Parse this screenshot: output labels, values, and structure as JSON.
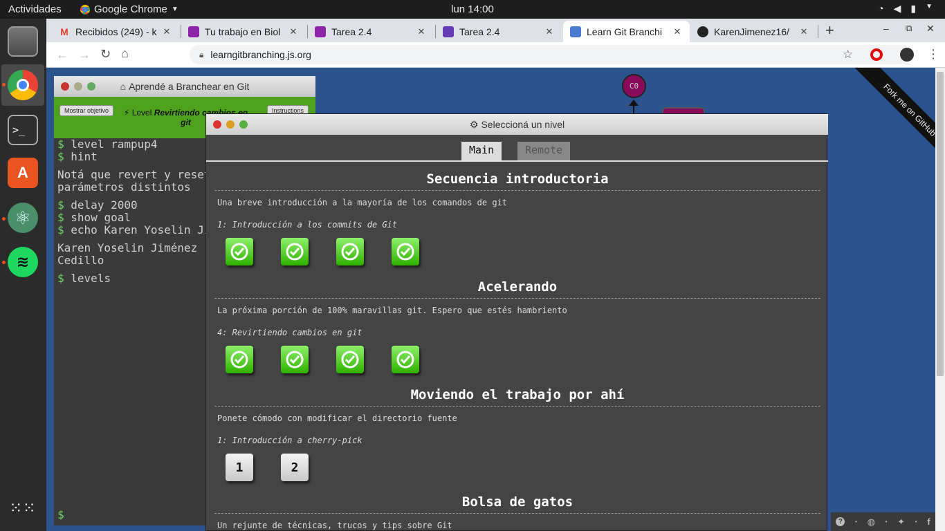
{
  "topbar": {
    "activities": "Actividades",
    "app_name": "Google Chrome",
    "clock": "lun 14:00"
  },
  "tabs": [
    {
      "title": "Recibidos (249) - k",
      "fav": "M",
      "color": "#ea4335"
    },
    {
      "title": "Tu trabajo en Biol",
      "fav": "",
      "color": "#8e24aa"
    },
    {
      "title": "Tarea 2.4",
      "fav": "",
      "color": "#8e24aa"
    },
    {
      "title": "Tarea 2.4",
      "fav": "",
      "color": "#673ab7"
    },
    {
      "title": "Learn Git Branchi",
      "fav": "",
      "color": "#4a7bd0"
    },
    {
      "title": "KarenJimenez16/",
      "fav": "",
      "color": "#222"
    }
  ],
  "address": {
    "url": "learngitbranching.js.org"
  },
  "terminal": {
    "title": "Aprendé a Branchear en Git",
    "show_goal": "Mostrar objetivo",
    "level_prefix": "Level",
    "level_name": "Revirtiendo cambios en git",
    "instructions": "Instructions",
    "lines": [
      {
        "text": "level rampup4",
        "cmd": true
      },
      {
        "text": "hint",
        "cmd": true
      },
      {
        "text": "Notá que revert y reset",
        "cmd": false
      },
      {
        "text": "parámetros distintos",
        "cmd": false
      },
      {
        "text": "delay 2000",
        "cmd": true
      },
      {
        "text": "show goal",
        "cmd": true
      },
      {
        "text": "echo Karen Yoselin Ji",
        "cmd": true
      },
      {
        "text": "Karen Yoselin Jiménez",
        "cmd": false
      },
      {
        "text": "Cedillo",
        "cmd": false
      },
      {
        "text": "levels",
        "cmd": true
      }
    ],
    "prompt": "$"
  },
  "git_node": {
    "label": "C0"
  },
  "modal": {
    "title": "Seleccioná un nivel",
    "tabs": [
      "Main",
      "Remote"
    ],
    "sections": [
      {
        "heading": "Secuencia introductoria",
        "desc": "Una breve introducción a la mayoría de los comandos de git",
        "level": "1: Introducción a los commits de Git",
        "boxes": [
          "done",
          "done",
          "done",
          "done"
        ]
      },
      {
        "heading": "Acelerando",
        "desc": "La próxima porción de 100% maravillas git. Espero que estés hambriento",
        "level": "4: Revirtiendo cambios en git",
        "boxes": [
          "done",
          "done",
          "done",
          "done"
        ]
      },
      {
        "heading": "Moviendo el trabajo por ahí",
        "desc": "Ponete cómodo con modificar el directorio fuente",
        "level": "1: Introducción a cherry-pick",
        "boxes": [
          "1",
          "2"
        ]
      },
      {
        "heading": "Bolsa de gatos",
        "desc": "Un rejunte de técnicas, trucos y tips sobre Git",
        "level": "",
        "boxes": []
      }
    ]
  },
  "ribbon": {
    "text": "Fork me on GitHub"
  },
  "footer": {
    "icons": [
      "?",
      "globe",
      "twitter",
      "f"
    ]
  }
}
